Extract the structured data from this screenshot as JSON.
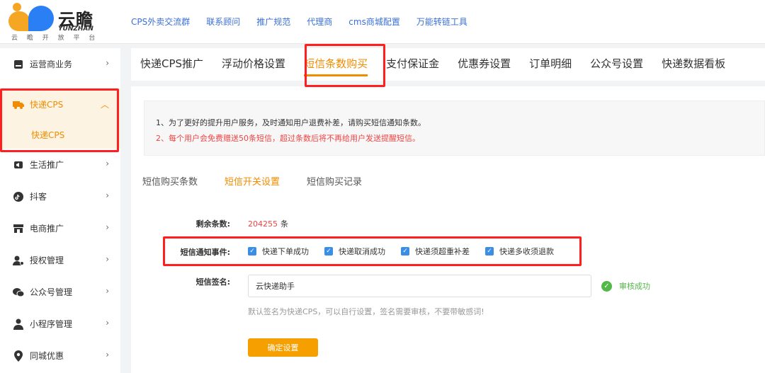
{
  "logo": {
    "brand": "云瞻",
    "brand_en": "YUNZHAN",
    "slogan": "云 瞻 开 放 平 台"
  },
  "topnav": [
    "CPS外卖交流群",
    "联系顾问",
    "推广规范",
    "代理商",
    "cms商城配置",
    "万能转链工具"
  ],
  "sidebar": {
    "items": [
      {
        "label": "运营商业务",
        "icon": "card-icon"
      },
      {
        "label": "快递CPS",
        "icon": "truck-icon"
      },
      {
        "label": "生活推广",
        "icon": "megaphone-icon"
      },
      {
        "label": "抖客",
        "icon": "douyin-icon"
      },
      {
        "label": "电商推广",
        "icon": "shop-icon"
      },
      {
        "label": "授权管理",
        "icon": "user-key-icon"
      },
      {
        "label": "公众号管理",
        "icon": "wechat-icon"
      },
      {
        "label": "小程序管理",
        "icon": "person-icon"
      },
      {
        "label": "同城优惠",
        "icon": "location-icon"
      }
    ],
    "sub_item": "快递CPS"
  },
  "tabs": [
    "快递CPS推广",
    "浮动价格设置",
    "短信条数购买",
    "支付保证金",
    "优惠券设置",
    "订单明细",
    "公众号设置",
    "快递数据看板"
  ],
  "notice": {
    "line1": "1、为了更好的提升用户服务，及时通知用户退费补差，请购买短信通知条数。",
    "line2": "2、每个用户会免费赠送50条短信，超过条数后将不再给用户发送提醒短信。"
  },
  "subtabs": [
    "短信购买条数",
    "短信开关设置",
    "短信购买记录"
  ],
  "form": {
    "remain_label": "剩余条数:",
    "remain_value": "204255",
    "remain_unit": "条",
    "events_label": "短信通知事件:",
    "events": [
      "快递下单成功",
      "快递取消成功",
      "快递须超重补差",
      "快递多收须退款"
    ],
    "signature_label": "短信签名:",
    "signature_value": "云快递助手",
    "verify_status": "审核成功",
    "hint": "默认签名为快递CPS，可以自行设置，签名需要审核，不要带敏感词!",
    "submit_label": "确定设置"
  },
  "colors": {
    "accent": "#f08c00",
    "highlight": "#ff1f1f",
    "link": "#3a6fd8",
    "success": "#52b848"
  }
}
